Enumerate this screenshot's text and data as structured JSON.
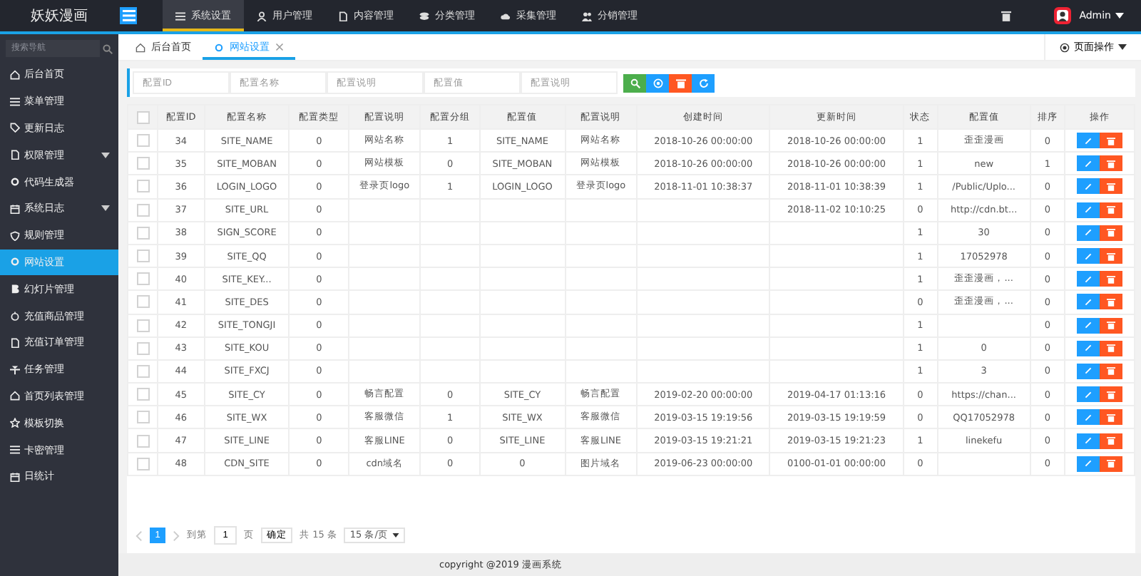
{
  "logo": "妖妖漫画",
  "top_nav": [
    {
      "label": "系统设置",
      "selected": true
    },
    {
      "label": "用户管理",
      "selected": false
    },
    {
      "label": "内容管理",
      "selected": false
    },
    {
      "label": "分类管理",
      "selected": false
    },
    {
      "label": "采集管理",
      "selected": false
    },
    {
      "label": "分销管理",
      "selected": false
    }
  ],
  "user": {
    "name": "Admin"
  },
  "sidebar": {
    "search_placeholder": "搜索导航",
    "items": [
      {
        "label": "后台首页",
        "selected": false,
        "expandable": false
      },
      {
        "label": "菜单管理",
        "selected": false,
        "expandable": false
      },
      {
        "label": "更新日志",
        "selected": false,
        "expandable": false
      },
      {
        "label": "权限管理",
        "selected": false,
        "expandable": true
      },
      {
        "label": "代码生成器",
        "selected": false,
        "expandable": false
      },
      {
        "label": "系统日志",
        "selected": false,
        "expandable": true
      },
      {
        "label": "规则管理",
        "selected": false,
        "expandable": false
      },
      {
        "label": "网站设置",
        "selected": true,
        "expandable": false
      },
      {
        "label": "幻灯片管理",
        "selected": false,
        "expandable": false
      },
      {
        "label": "充值商品管理",
        "selected": false,
        "expandable": false
      },
      {
        "label": "充值订单管理",
        "selected": false,
        "expandable": false
      },
      {
        "label": "任务管理",
        "selected": false,
        "expandable": false
      },
      {
        "label": "首页列表管理",
        "selected": false,
        "expandable": false
      },
      {
        "label": "模板切换",
        "selected": false,
        "expandable": false
      },
      {
        "label": "卡密管理",
        "selected": false,
        "expandable": false
      },
      {
        "label": "日统计",
        "selected": false,
        "expandable": false
      }
    ]
  },
  "tabs": [
    {
      "label": "后台首页",
      "selected": false,
      "closable": false
    },
    {
      "label": "网站设置",
      "selected": true,
      "closable": true
    }
  ],
  "page_actions": "页面操作",
  "filters": [
    {
      "placeholder": "配置ID"
    },
    {
      "placeholder": "配置名称"
    },
    {
      "placeholder": "配置说明"
    },
    {
      "placeholder": "配置值"
    },
    {
      "placeholder": "配置说明"
    }
  ],
  "filter_buttons": [
    {
      "kind": "search",
      "color": "#4cae4c"
    },
    {
      "kind": "add",
      "color": "#1e9fff"
    },
    {
      "kind": "delete",
      "color": "#ff5722"
    },
    {
      "kind": "refresh",
      "color": "#1e9fff"
    }
  ],
  "table": {
    "header_checked": false,
    "columns": [
      "配置ID",
      "配置名称",
      "配置类型",
      "配置说明",
      "配置分组",
      "配置值",
      "配置说明",
      "创建时间",
      "更新时间",
      "状态",
      "配置值",
      "排序",
      "操作"
    ],
    "rows": [
      {
        "checked": false,
        "cells": [
          "34",
          "SITE_NAME",
          "0",
          "网站名称",
          "1",
          "SITE_NAME",
          "网站名称",
          "2018-10-26 00:00:00",
          "2018-10-26 00:00:00",
          "1",
          "歪歪漫画",
          "0"
        ]
      },
      {
        "checked": false,
        "cells": [
          "35",
          "SITE_MOBAN",
          "0",
          "网站模板",
          "0",
          "SITE_MOBAN",
          "网站模板",
          "2018-10-26 00:00:00",
          "2018-10-26 00:00:00",
          "1",
          "new",
          "1"
        ]
      },
      {
        "checked": false,
        "cells": [
          "36",
          "LOGIN_LOGO",
          "0",
          "登录页logo",
          "1",
          "LOGIN_LOGO",
          "登录页logo",
          "2018-11-01 10:38:37",
          "2018-11-01 10:38:39",
          "1",
          "/Public/Uplo...",
          "0"
        ]
      },
      {
        "checked": false,
        "cells": [
          "37",
          "SITE_URL",
          "0",
          null,
          null,
          null,
          null,
          null,
          "2018-11-02 10:10:25",
          "0",
          "http://cdn.bt...",
          "0"
        ]
      },
      {
        "checked": false,
        "cells": [
          "38",
          "SIGN_SCORE",
          "0",
          null,
          null,
          null,
          null,
          null,
          null,
          "1",
          "30",
          "0"
        ]
      },
      {
        "checked": false,
        "cells": [
          "39",
          "SITE_QQ",
          "0",
          null,
          null,
          null,
          null,
          null,
          null,
          "1",
          "17052978",
          "0"
        ]
      },
      {
        "checked": false,
        "cells": [
          "40",
          "SITE_KEY...",
          "0",
          null,
          null,
          null,
          null,
          null,
          null,
          "1",
          "歪歪漫画，...",
          "0"
        ]
      },
      {
        "checked": false,
        "cells": [
          "41",
          "SITE_DES",
          "0",
          null,
          null,
          null,
          null,
          null,
          null,
          "0",
          "歪歪漫画，...",
          "0"
        ]
      },
      {
        "checked": false,
        "cells": [
          "42",
          "SITE_TONGJI",
          "0",
          null,
          null,
          null,
          null,
          null,
          null,
          "1",
          null,
          "0"
        ]
      },
      {
        "checked": false,
        "cells": [
          "43",
          "SITE_KOU",
          "0",
          null,
          null,
          null,
          null,
          null,
          null,
          "1",
          "0",
          "0"
        ]
      },
      {
        "checked": false,
        "cells": [
          "44",
          "SITE_FXCJ",
          "0",
          null,
          null,
          null,
          null,
          null,
          null,
          "1",
          "3",
          "0"
        ]
      },
      {
        "checked": false,
        "cells": [
          "45",
          "SITE_CY",
          "0",
          "畅言配置",
          "0",
          "SITE_CY",
          "畅言配置",
          "2019-02-20 00:00:00",
          "2019-04-17 01:13:16",
          "0",
          "https://chan...",
          "0"
        ]
      },
      {
        "checked": false,
        "cells": [
          "46",
          "SITE_WX",
          "0",
          "客服微信",
          "1",
          "SITE_WX",
          "客服微信",
          "2019-03-15 19:19:56",
          "2019-03-15 19:19:59",
          "0",
          "QQ17052978",
          "0"
        ]
      },
      {
        "checked": false,
        "cells": [
          "47",
          "SITE_LINE",
          "0",
          "客服LINE",
          "0",
          "SITE_LINE",
          "客服LINE",
          "2019-03-15 19:21:21",
          "2019-03-15 19:21:23",
          "1",
          "linekefu",
          "0"
        ]
      },
      {
        "checked": false,
        "cells": [
          "48",
          "CDN_SITE",
          "0",
          "cdn域名",
          "0",
          "0",
          "图片域名",
          "2019-06-23 00:00:00",
          "0100-01-01 00:00:00",
          "0",
          null,
          "0"
        ]
      }
    ]
  },
  "pagination": {
    "pages": [
      {
        "label": "1",
        "selected": true
      }
    ],
    "goto_label": "到第",
    "page_input": "1",
    "page_unit": "页",
    "confirm": "确定",
    "total": "共 15 条",
    "page_size": "15 条/页"
  },
  "footer": "copyright @2019 漫画系统"
}
